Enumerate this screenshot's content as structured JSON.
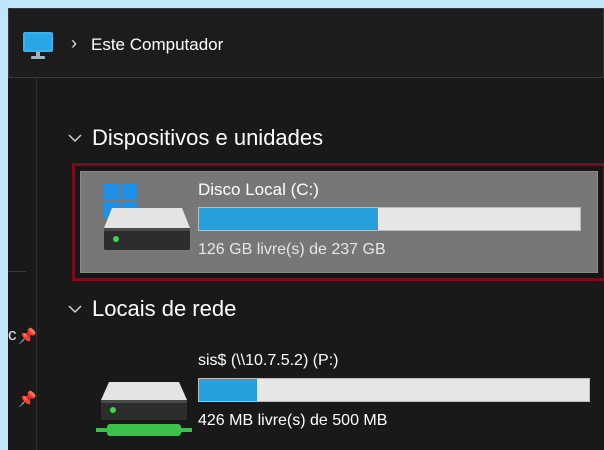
{
  "address_bar": {
    "location_icon": "computer-icon",
    "separator": "›",
    "breadcrumb": "Este Computador"
  },
  "nav_pane": {
    "partial_item_text": "c",
    "pin_icons": [
      "pin-icon",
      "pin-icon"
    ]
  },
  "groups": [
    {
      "title": "Dispositivos e unidades",
      "icon": "chevron-down-icon",
      "drives": [
        {
          "name": "Disco Local (C:)",
          "status": "126 GB livre(s) de 237 GB",
          "used_fraction": 0.47,
          "selected": true,
          "icon": "windows-drive-icon"
        }
      ]
    },
    {
      "title": "Locais de rede",
      "icon": "chevron-down-icon",
      "drives": [
        {
          "name": "sis$ (\\\\10.7.5.2) (P:)",
          "status": "426 MB livre(s) de 500 MB",
          "used_fraction": 0.148,
          "selected": false,
          "icon": "network-drive-icon"
        }
      ]
    }
  ],
  "colors": {
    "desktop_bg": "#bfe7fb",
    "window_bg": "#191919",
    "bar_fill": "#26a0da",
    "selection_outline": "#7a0b1e",
    "selected_tile_bg": "#777777"
  }
}
